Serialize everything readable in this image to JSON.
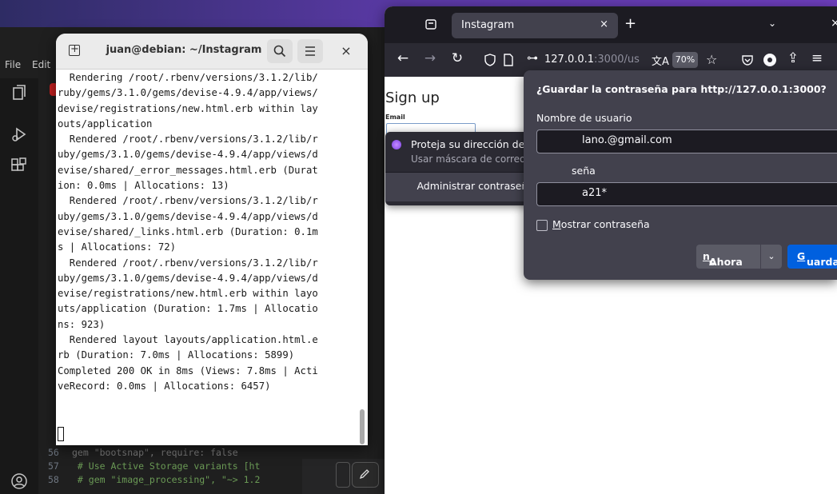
{
  "vscode": {
    "menu": [
      "File",
      "Edit"
    ],
    "editor_lines": [
      {
        "num": "56",
        "text": ""
      },
      {
        "num": "57",
        "text": "  # Use Active Storage variants [ht"
      },
      {
        "num": "58",
        "text": "  # gem \"image_processing\", \"~> 1.2"
      }
    ],
    "hidden_line": "gem \"bootsnap\", require: false"
  },
  "terminal": {
    "title": "juan@debian: ~/Instagram",
    "lines": [
      "  Rendering /root/.rbenv/versions/3.1.2/lib/",
      "ruby/gems/3.1.0/gems/devise-4.9.4/app/views/",
      "devise/registrations/new.html.erb within lay",
      "outs/application",
      "  Rendered /root/.rbenv/versions/3.1.2/lib/r",
      "uby/gems/3.1.0/gems/devise-4.9.4/app/views/d",
      "evise/shared/_error_messages.html.erb (Durat",
      "ion: 0.0ms | Allocations: 13)",
      "  Rendered /root/.rbenv/versions/3.1.2/lib/r",
      "uby/gems/3.1.0/gems/devise-4.9.4/app/views/d",
      "evise/shared/_links.html.erb (Duration: 0.1m",
      "s | Allocations: 72)",
      "  Rendered /root/.rbenv/versions/3.1.2/lib/r",
      "uby/gems/3.1.0/gems/devise-4.9.4/app/views/d",
      "evise/registrations/new.html.erb within layo",
      "uts/application (Duration: 1.7ms | Allocatio",
      "ns: 923)",
      "  Rendered layout layouts/application.html.e",
      "rb (Duration: 7.0ms | Allocations: 5899)",
      "Completed 200 OK in 8ms (Views: 7.8ms | Acti",
      "veRecord: 0.0ms | Allocations: 6457)"
    ]
  },
  "firefox": {
    "tab_title": "Instagram",
    "tab_close": "×",
    "new_tab": "+",
    "list_tabs": "⌄",
    "window_close": "×",
    "url_host": "127.0.0.1",
    "url_rest": ":3000/us",
    "zoom": "70%",
    "page": {
      "title": "Sign up",
      "email_label": "Email"
    },
    "autocomplete": {
      "relay_title": "Proteja su dirección de correo…",
      "relay_subtitle": "Usar máscara de correo elect…",
      "manage": "Administrar contraseñas"
    },
    "save_dialog": {
      "title": "¿Guardar la contraseña para http://127.0.0.1:3000?",
      "username_label": "Nombre de usuario",
      "username_value": "lano.@gmail.com",
      "password_label": "seña",
      "password_value": "a21*",
      "show_password_prefix": "M",
      "show_password_rest": "ostrar contraseña",
      "not_now_prefix": "Ahora ",
      "not_now_underlined": "n",
      "not_now_suffix": "o",
      "save_underlined": "G",
      "save_rest": "uardar"
    }
  },
  "colors": {
    "firefox_dark": "#1c1b22",
    "firefox_panel": "#42414d",
    "save_blue": "#0060df",
    "terminal_bg": "#ffffff"
  }
}
